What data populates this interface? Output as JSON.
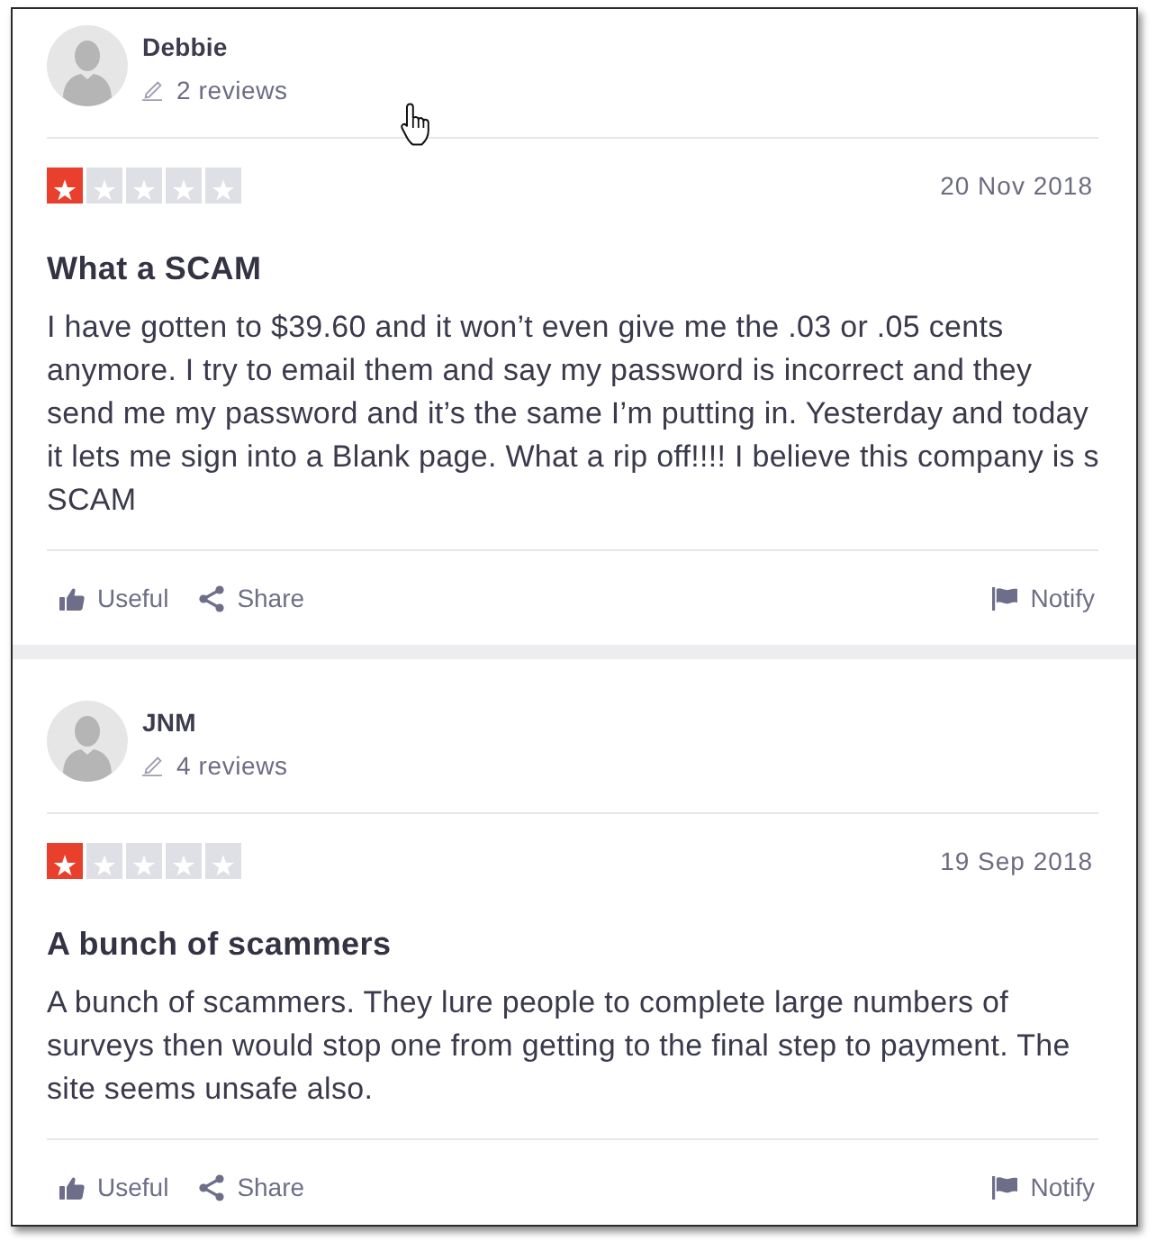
{
  "reviews": [
    {
      "author": "Debbie",
      "review_count": "2 reviews",
      "stars": 1,
      "date": "20 Nov 2018",
      "title": "What a SCAM",
      "body": "I have gotten to $39.60 and it won’t even give me the .03 or .05 cents anymore. I try to email them and say my password is incorrect and they send me my password and it’s the same I’m putting in. Yesterday and today it lets me sign into a Blank page. What a rip off!!!! I believe this company is s SCAM",
      "actions": [
        {
          "kind": "useful",
          "label": "Useful"
        },
        {
          "kind": "share",
          "label": "Share"
        },
        {
          "kind": "notify",
          "label": "Notify"
        }
      ]
    },
    {
      "author": "JNM",
      "review_count": "4 reviews",
      "stars": 1,
      "date": "19 Sep 2018",
      "title": "A bunch of scammers",
      "body": "A bunch of scammers. They lure people to complete large numbers of surveys then would stop one from getting to the final step to payment. The site seems unsafe also.",
      "actions": [
        {
          "kind": "useful",
          "label": "Useful"
        },
        {
          "kind": "share",
          "label": "Share"
        },
        {
          "kind": "notify",
          "label": "Notify"
        }
      ]
    }
  ],
  "mouse_cursor": {
    "kind": "hand"
  }
}
